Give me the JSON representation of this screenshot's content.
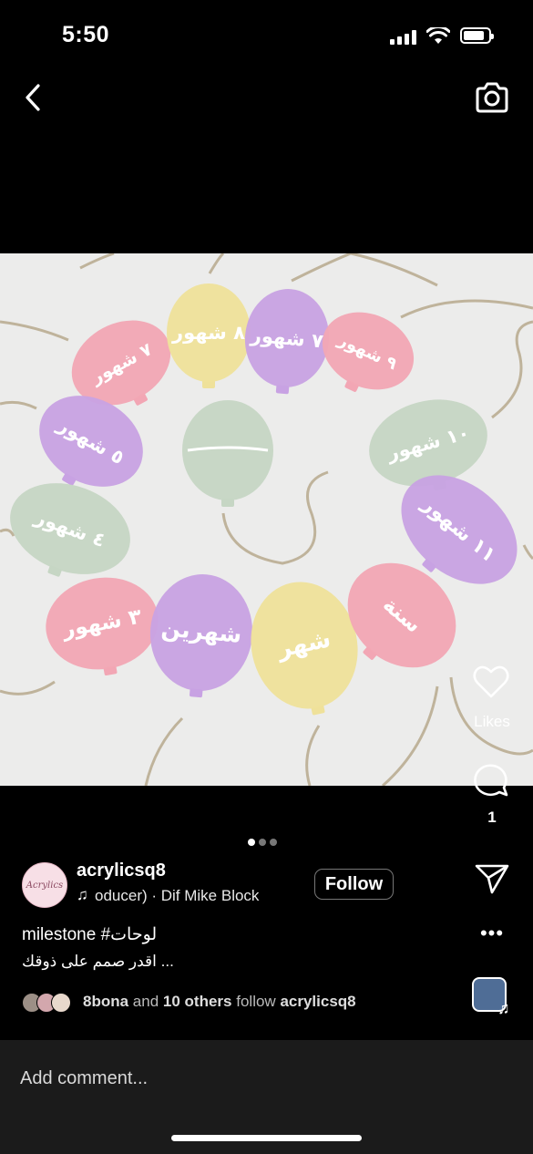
{
  "status_bar": {
    "time": "5:50"
  },
  "photo": {
    "balloons": [
      {
        "label": "٧ شهور",
        "color": "#f2a6b4"
      },
      {
        "label": "٨ شهور",
        "color": "#efe19a"
      },
      {
        "label": "٧ شهور",
        "color": "#c8a2e3"
      },
      {
        "label": "٩ شهور",
        "color": "#f2a6b4"
      },
      {
        "label": "٥ شهور",
        "color": "#c8a2e3"
      },
      {
        "label": "",
        "color": "#c6d6c4"
      },
      {
        "label": "١٠ شهور",
        "color": "#c6d6c4"
      },
      {
        "label": "٤ شهور",
        "color": "#c6d6c4"
      },
      {
        "label": "١١ شهور",
        "color": "#c8a2e3"
      },
      {
        "label": "٣ شهور",
        "color": "#f2a6b4"
      },
      {
        "label": "شهرين",
        "color": "#c8a2e3"
      },
      {
        "label": "شهر",
        "color": "#efe19a"
      },
      {
        "label": "سنة",
        "color": "#f2a6b4"
      }
    ]
  },
  "actions": {
    "likes_label": "Likes",
    "comment_count": "1"
  },
  "post": {
    "username": "acrylicsq8",
    "avatar_text": "Acrylics",
    "audio": "oducer) · Dif      Mike Block",
    "follow_label": "Follow",
    "caption_line1": "milestone #لوحات",
    "caption_line2": "اقدر صمم على ذوقك ...",
    "followers": {
      "first": "8bona",
      "and": "and",
      "others": "10 others",
      "tail": "follow",
      "account": "acrylicsq8"
    }
  },
  "comment_bar": {
    "placeholder": "Add comment..."
  },
  "icons": [
    "back-icon",
    "camera-icon",
    "heart-icon",
    "comment-icon",
    "share-icon",
    "more-icon",
    "music-note-icon"
  ]
}
